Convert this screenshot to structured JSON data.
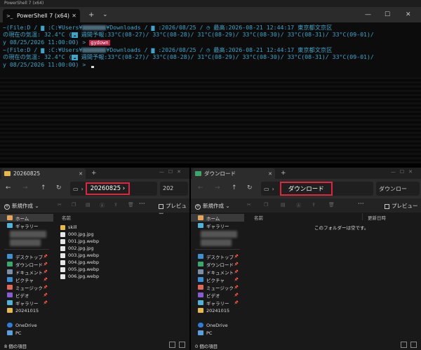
{
  "terminal": {
    "window_title": "PowerShell 7 (x64)",
    "tab_title": "PowerShell 7 (x64)",
    "tab_icon_glyph": ">_",
    "new_tab_glyph": "+",
    "dropdown_glyph": "⌄",
    "close_glyph": "✕",
    "window_controls": [
      "—",
      "☐",
      "✕"
    ],
    "lines": [
      {
        "a": "~(File:D / ",
        "b": " :C:¥Users¥",
        "c": "¥Downloads / ",
        "d": " :2026/08/25 / ",
        "e": " 最高:2026-08-21 12:44:17 東京都文京区"
      },
      {
        "a": "の現在の気温: 32.4°C (",
        "b": " 週間予報:33°C(08-27)/  33°C(08-28)/  31°C(08-29)/  33°C(08-30)/  33°C(08-31)/  33°C(09-01)/"
      },
      {
        "a": "y 08/25/2026 11:00:00) > ",
        "badge": "gydown"
      },
      {
        "a": "~(File:D / ",
        "b": " :C:¥Users¥",
        "c": "¥Downloads / ",
        "d": " :2026/08/25 / ",
        "e": " 最高:2026-08-21 12:44:17 東京都文京区"
      },
      {
        "a": "の現在の気温: 32.4°C (",
        "b": " 週間予報:33°C(08-27)/  33°C(08-28)/  31°C(08-29)/  33°C(08-30)/  33°C(08-31)/  33°C(09-01)/"
      },
      {
        "a": "y 08/25/2026 11:00:00) > "
      }
    ]
  },
  "left_explorer": {
    "tab_title": "20260825",
    "close_glyph": "✕",
    "new_tab_glyph": "+",
    "nav": {
      "back": "←",
      "forward": "→",
      "up": "↑",
      "refresh": "↻",
      "chevron": "›"
    },
    "breadcrumb": "20260825",
    "search_text": "202",
    "new_button": "新規作成",
    "more": "···",
    "preview": "プレビュー",
    "column_name": "名前",
    "sidebar": {
      "home": "ホーム",
      "gallery": "ギャラリー",
      "items": [
        "デスクトップ",
        "ダウンロード",
        "ドキュメント",
        "ピクチャ",
        "ミュージック",
        "ビデオ",
        "ギャラリー",
        "20241015"
      ],
      "onedrive": "OneDrive",
      "pc": "PC"
    },
    "files": [
      "skill",
      "000.jpg.jpg",
      "001.jpg.webp",
      "002.jpg.jpg",
      "003.jpg.webp",
      "004.jpg.webp",
      "005.jpg.webp",
      "006.jpg.webp"
    ],
    "status": "8 個の項目"
  },
  "right_explorer": {
    "tab_title": "ダウンロード",
    "close_glyph": "✕",
    "new_tab_glyph": "+",
    "nav": {
      "back": "←",
      "forward": "→",
      "up": "↑",
      "refresh": "↻",
      "chevron": "›"
    },
    "breadcrumb": "ダウンロード",
    "search_text": "ダウンロー",
    "new_button": "新規作成",
    "more": "···",
    "preview": "プレビュー",
    "column_name": "名前",
    "column_date": "更新日時",
    "empty_message": "このフォルダーは空です。",
    "sidebar": {
      "home": "ホーム",
      "gallery": "ギャラリー",
      "items": [
        "デスクトップ",
        "ダウンロード",
        "ドキュメント",
        "ピクチャ",
        "ミュージック",
        "ビデオ",
        "ギャラリー",
        "20241015"
      ],
      "onedrive": "OneDrive",
      "pc": "PC"
    },
    "status": "0 個の項目"
  },
  "colors": {
    "terminal_text": "#3ba5c9",
    "highlight_border": "#e0263f",
    "folder": "#e7b94b"
  }
}
